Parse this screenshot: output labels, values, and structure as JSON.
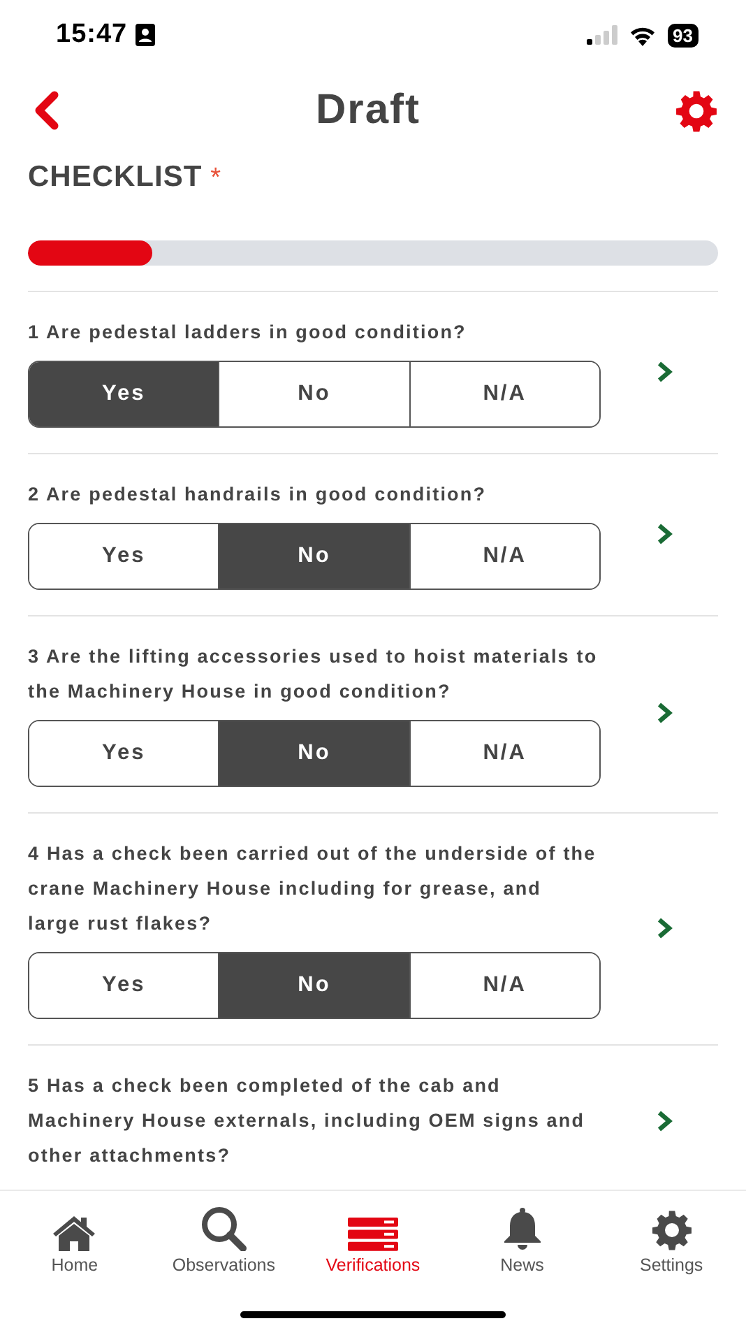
{
  "status_bar": {
    "time": "15:47",
    "battery": "93"
  },
  "header": {
    "title": "Draft"
  },
  "checklist": {
    "title": "CHECKLIST",
    "required_mark": "*",
    "progress": {
      "level": 0.18
    }
  },
  "questions": [
    {
      "text": "1 Are pedestal ladders in good condition?",
      "options": [
        {
          "label": "Yes",
          "selected": true
        },
        {
          "label": "No",
          "selected": false
        },
        {
          "label": "N/A",
          "selected": false
        }
      ]
    },
    {
      "text": "2 Are pedestal handrails in good condition?",
      "options": [
        {
          "label": "Yes",
          "selected": false
        },
        {
          "label": "No",
          "selected": true
        },
        {
          "label": "N/A",
          "selected": false
        }
      ]
    },
    {
      "text": "3 Are the lifting accessories used to hoist materials to the Machinery House in good condition?",
      "options": [
        {
          "label": "Yes",
          "selected": false
        },
        {
          "label": "No",
          "selected": true
        },
        {
          "label": "N/A",
          "selected": false
        }
      ]
    },
    {
      "text": "4 Has a check been carried out of the underside of the crane Machinery House including for grease, and large rust flakes?",
      "options": [
        {
          "label": "Yes",
          "selected": false
        },
        {
          "label": "No",
          "selected": true
        },
        {
          "label": "N/A",
          "selected": false
        }
      ]
    },
    {
      "text": "5 Has a check been completed of the cab and Machinery House externals, including OEM signs and other attachments?"
    }
  ],
  "tabs": [
    {
      "kind": "home",
      "label": "Home",
      "selected": false
    },
    {
      "kind": "search",
      "label": "Observations",
      "selected": false
    },
    {
      "kind": "list",
      "label": "Verifications",
      "selected": true
    },
    {
      "kind": "bell",
      "label": "News",
      "selected": false
    },
    {
      "kind": "gear",
      "label": "Settings",
      "selected": false
    }
  ]
}
